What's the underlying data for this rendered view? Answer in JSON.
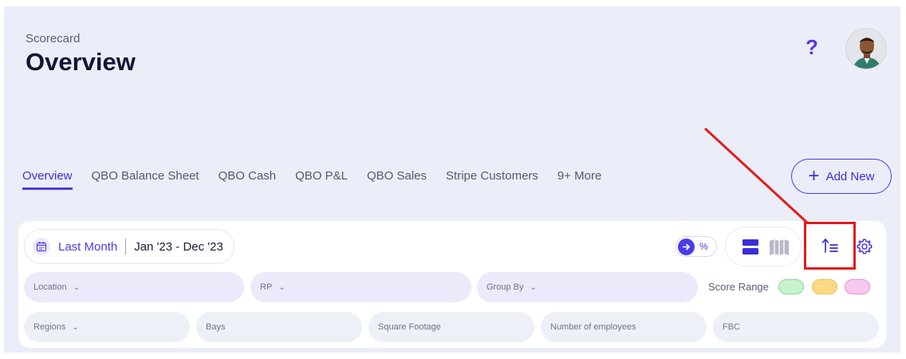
{
  "header": {
    "subtitle": "Scorecard",
    "title": "Overview",
    "help_label": "?"
  },
  "tabs": [
    {
      "label": "Overview",
      "active": true
    },
    {
      "label": "QBO Balance Sheet"
    },
    {
      "label": "QBO Cash"
    },
    {
      "label": "QBO P&L"
    },
    {
      "label": "QBO Sales"
    },
    {
      "label": "Stripe Customers"
    },
    {
      "label": "9+ More"
    }
  ],
  "add_new": {
    "plus": "+",
    "label": "Add New"
  },
  "date_filter": {
    "label": "Last Month",
    "range": "Jan '23 - Dec '23"
  },
  "percent_toggle": {
    "label": "%"
  },
  "filters_row1": {
    "location": "Location",
    "rp": "RP",
    "group_by": "Group By"
  },
  "score_range": {
    "label": "Score Range",
    "colors": {
      "green": "#c8f2cc",
      "yellow": "#fdd985",
      "pink": "#f8c9ef"
    }
  },
  "filters_row2": {
    "regions": "Regions",
    "bays": "Bays",
    "square_footage": "Square Footage",
    "employees": "Number of employees",
    "fbc": "FBC"
  },
  "icons": [
    "calendar-icon",
    "arrow-right-icon",
    "list-view-icon",
    "map-view-icon",
    "sort-icon",
    "gear-icon",
    "chevron-down-icon"
  ],
  "colors": {
    "accent": "#4b3ce8",
    "annotation": "#e21b1b",
    "panel": "#ebedf8"
  }
}
